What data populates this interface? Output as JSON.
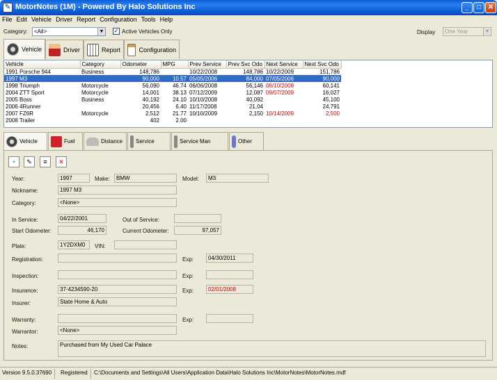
{
  "window": {
    "title": "MotorNotes (1M) - Powered By Halo Solutions Inc",
    "icon": "app-notes-icon"
  },
  "menu": [
    "File",
    "Edit",
    "Vehicle",
    "Driver",
    "Report",
    "Configuration",
    "Tools",
    "Help"
  ],
  "filter": {
    "category_label": "Category:",
    "category_value": "<All>",
    "active_only_label": "Active Vehicles Only",
    "display_label": "Display",
    "display_value": "One Year"
  },
  "main_tabs": [
    {
      "label": "Vehicle",
      "icon": "wheel-icon"
    },
    {
      "label": "Driver",
      "icon": "driver-icon"
    },
    {
      "label": "Report",
      "icon": "report-grid-icon"
    },
    {
      "label": "Configuration",
      "icon": "clipboard-icon"
    }
  ],
  "vehicle_table": {
    "columns": [
      "Vehicle",
      "Category",
      "Odometer",
      "MPG",
      "Prev Service",
      "Prev Svc Odo",
      "Next Service",
      "Next Svc Odo"
    ],
    "rows": [
      [
        "1991 Porsche 944",
        "Business",
        "148,786",
        "",
        "10/22/2008",
        "148,786",
        "10/22/2009",
        "151,786"
      ],
      [
        "1997 M3",
        "",
        "90,000",
        "10.57",
        "05/05/2006",
        "84,000",
        "07/05/2006",
        "90,000"
      ],
      [
        "1998 Triumph",
        "Motorcycle",
        "56,090",
        "46.74",
        "06/06/2008",
        "56,146",
        "06/10/2008",
        "60,141"
      ],
      [
        "2004 ZTT Sport",
        "Motorcycle",
        "14,001",
        "38.13",
        "07/12/2009",
        "12,087",
        "09/07/2009",
        "16,027"
      ],
      [
        "2005 Boss",
        "Business",
        "40,192",
        "24.10",
        "10/10/2008",
        "40,092",
        "",
        "45,100"
      ],
      [
        "2006 4Runner",
        "",
        "20,456",
        "6.40",
        "11/17/2008",
        "21,04",
        "",
        "24,791"
      ],
      [
        "2007 FZ6R",
        "Motorcycle",
        "2,512",
        "21.77",
        "10/10/2009",
        "2,150",
        "10/14/2009",
        "2,500"
      ],
      [
        "2008 Trailer",
        "",
        "402",
        "2.00",
        "",
        "",
        "",
        ""
      ]
    ]
  },
  "detail_tabs": [
    {
      "label": "Vehicle",
      "icon": "wheel-icon"
    },
    {
      "label": "Fuel",
      "icon": "fuel-can-icon"
    },
    {
      "label": "Distance",
      "icon": "car-icon"
    },
    {
      "label": "Service",
      "icon": "wrench-icon"
    },
    {
      "label": "Service Man",
      "icon": "screwdriver-icon"
    },
    {
      "label": "Other",
      "icon": "other-icon"
    }
  ],
  "tool_buttons": [
    "add-record-icon",
    "edit-record-icon",
    "notes-icon",
    "delete-record-icon"
  ],
  "form": {
    "year_label": "Year:",
    "year": "1997",
    "make_label": "Make:",
    "make": "BMW",
    "model_label": "Model:",
    "model": "M3",
    "nickname_label": "Nickname:",
    "nickname": "1997 M3",
    "category_label": "Category:",
    "category": "<None>",
    "in_service_label": "In Service:",
    "in_service": "04/22/2001",
    "out_service_label": "Out of Service:",
    "out_service": "",
    "start_odo_label": "Start Odometer:",
    "start_odo": "46,170",
    "current_odo_label": "Current Odometer:",
    "current_odo": "97,057",
    "plate_label": "Plate:",
    "plate": "1Y2DXM0",
    "vin_label": "VIN:",
    "vin": "",
    "registration_label": "Registration:",
    "registration": "",
    "reg_exp_label": "Exp:",
    "reg_exp": "04/30/2011",
    "inspection_label": "Inspection:",
    "inspection": "",
    "insp_exp_label": "Exp:",
    "insp_exp": "",
    "insurance_label": "Insurance:",
    "insurance": "37-4234590-20",
    "ins_exp_label": "Exp:",
    "ins_exp": "02/01/2008",
    "insurer_label": "Insurer:",
    "insurer": "State Home & Auto",
    "warranty_label": "Warranty:",
    "warranty": "",
    "war_exp_label": "Exp:",
    "war_exp": "",
    "warrantor_label": "Warrantor:",
    "warrantor": "<None>",
    "notes_label": "Notes:",
    "notes": "Purchased from My Used Car Palace"
  },
  "status": {
    "version": "Version 9.5.0.37690",
    "registered": "Registered",
    "path": "C:\\Documents and Settings\\All Users\\Application Data\\Halo Solutions Inc\\MotorNotes\\MotorNotes.mdf"
  },
  "colors": {
    "title_blue": "#0a5fd8",
    "selection": "#316ac5",
    "overdue_red": "#d00000"
  }
}
